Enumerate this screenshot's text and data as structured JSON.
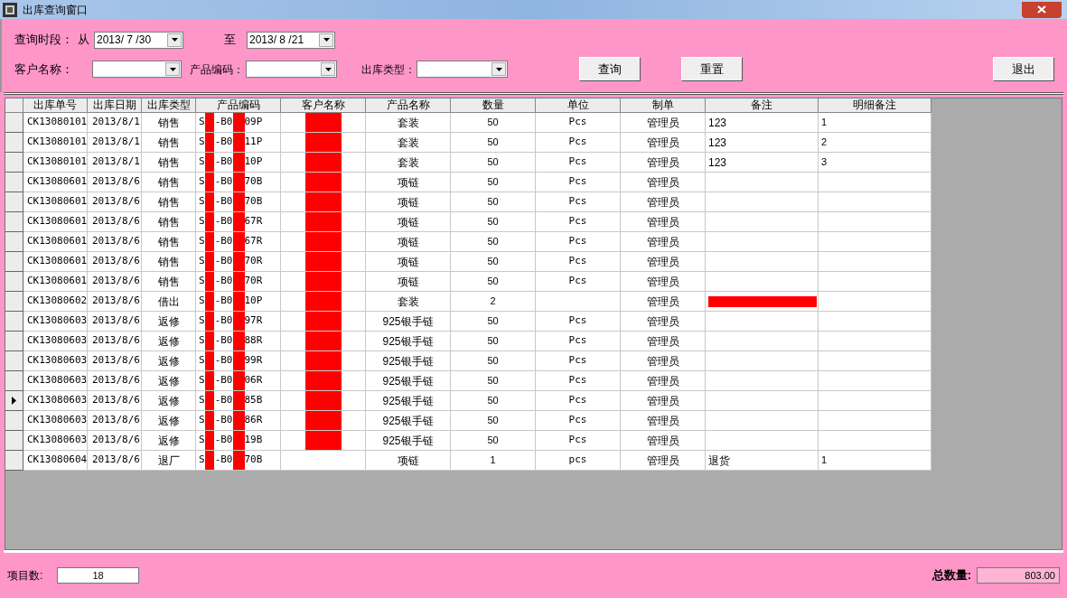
{
  "window": {
    "title": "出库查询窗口"
  },
  "filters": {
    "period_label": "查询时段：",
    "from_label": "从",
    "from_date": "2013/ 7 /30",
    "to_label": "至",
    "to_date": "2013/ 8 /21",
    "customer_label": "客户名称：",
    "product_code_label": "产品编码：",
    "type_label": "出库类型："
  },
  "buttons": {
    "query": "查询",
    "reset": "重置",
    "exit": "退出"
  },
  "table": {
    "columns": [
      "出库单号",
      "出库日期",
      "出库类型",
      "产品编码",
      "客户名称",
      "产品名称",
      "数量",
      "单位",
      "制单",
      "备注",
      "明细备注"
    ],
    "rows": [
      {
        "selected": false,
        "no": "CK13080101",
        "date": "2013/8/1",
        "type": "销售",
        "code_parts": [
          "S",
          "-B0",
          "09P"
        ],
        "customer_redacted": true,
        "product": "套装",
        "qty": "50",
        "unit": "Pcs",
        "maker": "管理员",
        "remark": "123",
        "remark_redacted": false,
        "detail": "1"
      },
      {
        "selected": false,
        "no": "CK13080101",
        "date": "2013/8/1",
        "type": "销售",
        "code_parts": [
          "S",
          "-B0",
          "11P"
        ],
        "customer_redacted": true,
        "product": "套装",
        "qty": "50",
        "unit": "Pcs",
        "maker": "管理员",
        "remark": "123",
        "remark_redacted": false,
        "detail": "2"
      },
      {
        "selected": false,
        "no": "CK13080101",
        "date": "2013/8/1",
        "type": "销售",
        "code_parts": [
          "S",
          "-B0",
          "10P"
        ],
        "customer_redacted": true,
        "product": "套装",
        "qty": "50",
        "unit": "Pcs",
        "maker": "管理员",
        "remark": "123",
        "remark_redacted": false,
        "detail": "3"
      },
      {
        "selected": false,
        "no": "CK13080601",
        "date": "2013/8/6",
        "type": "销售",
        "code_parts": [
          "S",
          "-B0",
          "70B"
        ],
        "customer_redacted": true,
        "product": "项链",
        "qty": "50",
        "unit": "Pcs",
        "maker": "管理员",
        "remark_redacted": false
      },
      {
        "selected": false,
        "no": "CK13080601",
        "date": "2013/8/6",
        "type": "销售",
        "code_parts": [
          "S",
          "-B0",
          "70B"
        ],
        "customer_redacted": true,
        "product": "项链",
        "qty": "50",
        "unit": "Pcs",
        "maker": "管理员",
        "remark_redacted": false
      },
      {
        "selected": false,
        "no": "CK13080601",
        "date": "2013/8/6",
        "type": "销售",
        "code_parts": [
          "S",
          "-B0",
          "67R"
        ],
        "customer_redacted": true,
        "product": "项链",
        "qty": "50",
        "unit": "Pcs",
        "maker": "管理员",
        "remark_redacted": false
      },
      {
        "selected": false,
        "no": "CK13080601",
        "date": "2013/8/6",
        "type": "销售",
        "code_parts": [
          "S",
          "-B0",
          "67R"
        ],
        "customer_redacted": true,
        "product": "项链",
        "qty": "50",
        "unit": "Pcs",
        "maker": "管理员",
        "remark_redacted": false
      },
      {
        "selected": false,
        "no": "CK13080601",
        "date": "2013/8/6",
        "type": "销售",
        "code_parts": [
          "S",
          "-B0",
          "70R"
        ],
        "customer_redacted": true,
        "product": "项链",
        "qty": "50",
        "unit": "Pcs",
        "maker": "管理员",
        "remark_redacted": false
      },
      {
        "selected": false,
        "no": "CK13080601",
        "date": "2013/8/6",
        "type": "销售",
        "code_parts": [
          "S",
          "-B0",
          "70R"
        ],
        "customer_redacted": true,
        "product": "项链",
        "qty": "50",
        "unit": "Pcs",
        "maker": "管理员",
        "remark_redacted": false
      },
      {
        "selected": false,
        "no": "CK13080602",
        "date": "2013/8/6",
        "type": "借出",
        "code_parts": [
          "S",
          "-B0",
          "10P"
        ],
        "customer_redacted": true,
        "product": "套装",
        "qty": "2",
        "maker": "管理员",
        "remark_redacted": true
      },
      {
        "selected": false,
        "no": "CK13080603",
        "date": "2013/8/6",
        "type": "返修",
        "code_parts": [
          "S",
          "-B0",
          "97R"
        ],
        "customer_redacted": true,
        "product": "925银手链",
        "qty": "50",
        "unit": "Pcs",
        "maker": "管理员",
        "remark_redacted": false
      },
      {
        "selected": false,
        "no": "CK13080603",
        "date": "2013/8/6",
        "type": "返修",
        "code_parts": [
          "S",
          "-B0",
          "88R"
        ],
        "customer_redacted": true,
        "product": "925银手链",
        "qty": "50",
        "unit": "Pcs",
        "maker": "管理员",
        "remark_redacted": false
      },
      {
        "selected": false,
        "no": "CK13080603",
        "date": "2013/8/6",
        "type": "返修",
        "code_parts": [
          "S",
          "-B0",
          "99R"
        ],
        "customer_redacted": true,
        "product": "925银手链",
        "qty": "50",
        "unit": "Pcs",
        "maker": "管理员",
        "remark_redacted": false
      },
      {
        "selected": false,
        "no": "CK13080603",
        "date": "2013/8/6",
        "type": "返修",
        "code_parts": [
          "S",
          "-B0",
          "06R"
        ],
        "customer_redacted": true,
        "product": "925银手链",
        "qty": "50",
        "unit": "Pcs",
        "maker": "管理员",
        "remark_redacted": false
      },
      {
        "selected": true,
        "no": "CK13080603",
        "date": "2013/8/6",
        "type": "返修",
        "code_parts": [
          "S",
          "-B0",
          "85B"
        ],
        "customer_redacted": true,
        "product": "925银手链",
        "qty": "50",
        "unit": "Pcs",
        "maker": "管理员",
        "remark_redacted": false
      },
      {
        "selected": false,
        "no": "CK13080603",
        "date": "2013/8/6",
        "type": "返修",
        "code_parts": [
          "S",
          "-B0",
          "86R"
        ],
        "customer_redacted": true,
        "product": "925银手链",
        "qty": "50",
        "unit": "Pcs",
        "maker": "管理员",
        "remark_redacted": false
      },
      {
        "selected": false,
        "no": "CK13080603",
        "date": "2013/8/6",
        "type": "返修",
        "code_parts": [
          "S",
          "-B0",
          "19B"
        ],
        "customer_redacted": true,
        "product": "925银手链",
        "qty": "50",
        "unit": "Pcs",
        "maker": "管理员",
        "remark_redacted": false
      },
      {
        "selected": false,
        "no": "CK13080604",
        "date": "2013/8/6",
        "type": "退厂",
        "code_parts": [
          "S",
          "-B0",
          "70B"
        ],
        "customer_redacted": false,
        "product": "项链",
        "qty": "1",
        "unit": "pcs",
        "maker": "管理员",
        "remark": "退货",
        "remark_redacted": false,
        "detail": "1"
      }
    ]
  },
  "footer": {
    "count_label": "项目数:",
    "count": "18",
    "total_label": "总数量:",
    "total": "803.00"
  }
}
